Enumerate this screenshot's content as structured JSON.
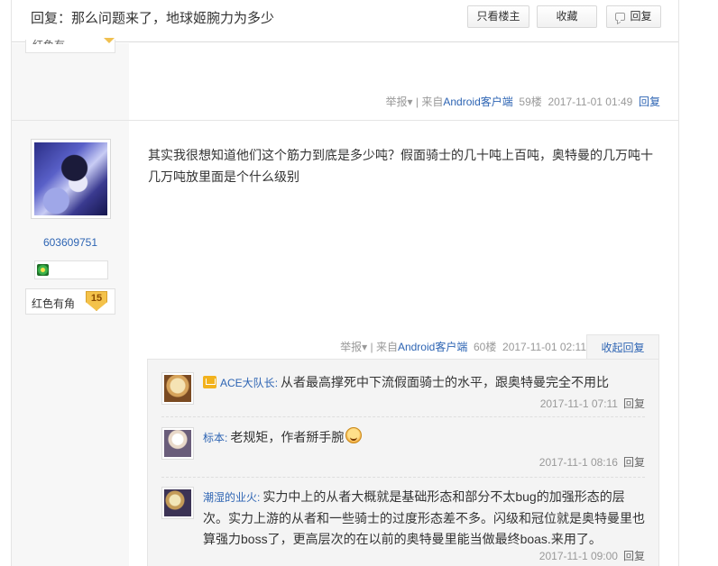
{
  "header": {
    "title": "回复：那么问题来了，地球姬腕力为多少",
    "btn_only_op": "只看楼主",
    "btn_favorite": "收藏",
    "btn_reply": "回复"
  },
  "prev_post": {
    "report": "举报",
    "source_prefix": "来自",
    "source_link": "Android客户端",
    "floor": "59楼",
    "time": "2017-11-01 01:49",
    "reply": "回复"
  },
  "post": {
    "username": "603609751",
    "level_name": "红色有角",
    "level_num": "15",
    "content": "其实我很想知道他们这个筋力到底是多少吨？假面骑士的几十吨上百吨，奥特曼的几万吨十几万吨放里面是个什么级别",
    "report": "举报",
    "source_prefix": "来自",
    "source_link": "Android客户端",
    "floor": "60楼",
    "time": "2017-11-01 02:11",
    "fold_reply": "收起回复"
  },
  "sub_replies": [
    {
      "name": "ACE大队长",
      "text": "从者最高撑死中下流假面骑士的水平，跟奥特曼完全不用比",
      "time": "2017-11-1 07:11",
      "reply": "回复"
    },
    {
      "name": "标本",
      "text": "老规矩，作者掰手腕",
      "time": "2017-11-1 08:16",
      "reply": "回复"
    },
    {
      "name": "潮湿的业火",
      "text": "实力中上的从者大概就是基础形态和部分不太bug的加强形态的层次。实力上游的从者和一些骑士的过度形态差不多。闪级和冠位就是奥特曼里也算强力boss了，更高层次的在以前的奥特曼里能当做最终boas.来用了。",
      "time": "2017-11-1 09:00",
      "reply": "回复"
    }
  ]
}
